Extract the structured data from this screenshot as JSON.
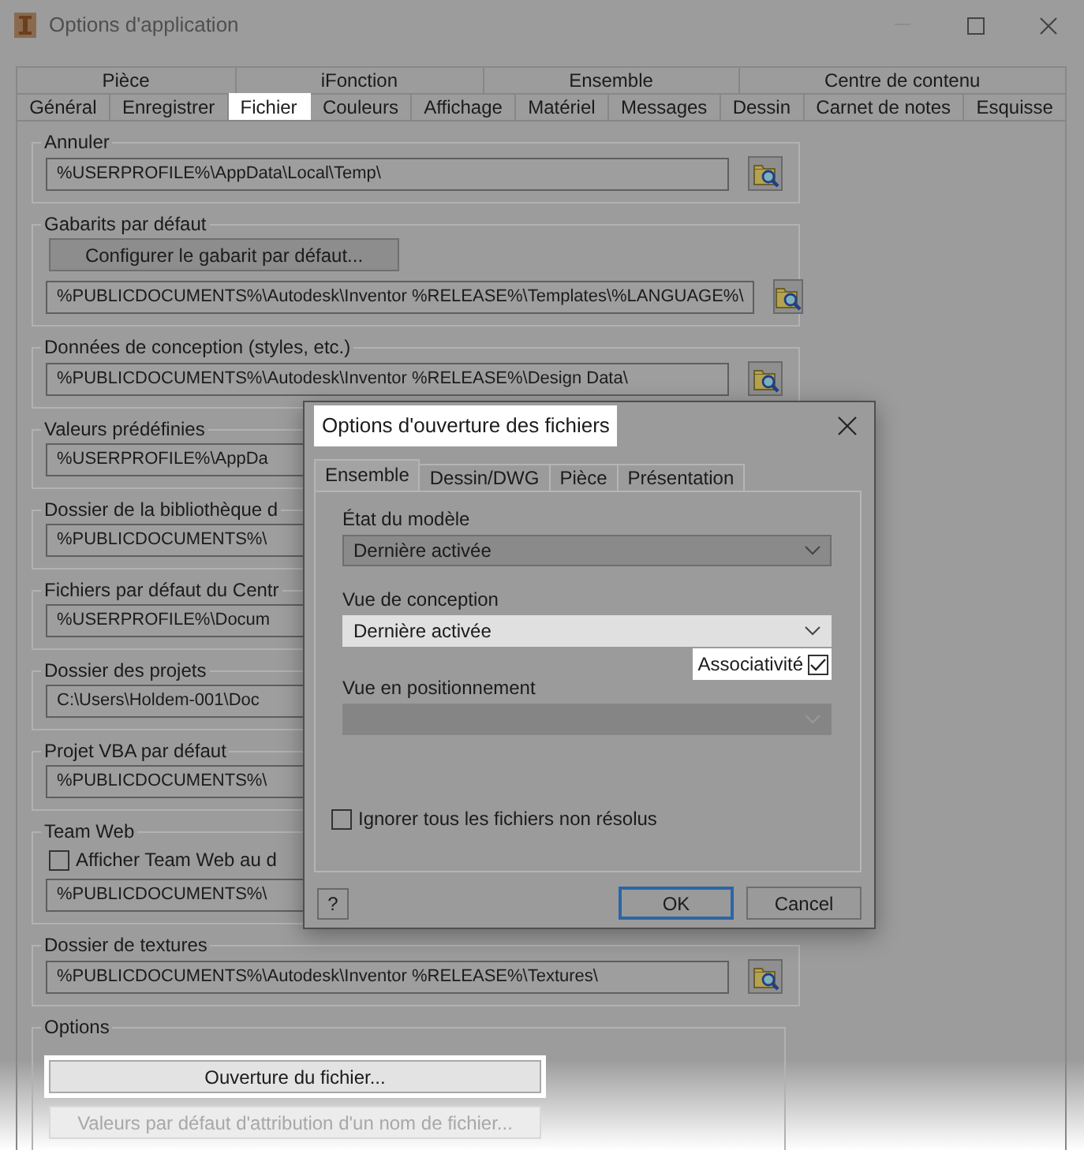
{
  "window": {
    "title": "Options d'application"
  },
  "tab_rows": [
    [
      {
        "label": "Pièce",
        "selected": false
      },
      {
        "label": "iFonction",
        "selected": false
      },
      {
        "label": "Ensemble",
        "selected": false
      },
      {
        "label": "Centre de contenu",
        "selected": false
      }
    ],
    [
      {
        "label": "Général",
        "selected": false
      },
      {
        "label": "Enregistrer",
        "selected": false
      },
      {
        "label": "Fichier",
        "selected": true
      },
      {
        "label": "Couleurs",
        "selected": false
      },
      {
        "label": "Affichage",
        "selected": false
      },
      {
        "label": "Matériel",
        "selected": false
      },
      {
        "label": "Messages",
        "selected": false
      },
      {
        "label": "Dessin",
        "selected": false
      },
      {
        "label": "Carnet de notes",
        "selected": false
      },
      {
        "label": "Esquisse",
        "selected": false
      }
    ]
  ],
  "groups": [
    {
      "legend": "Annuler",
      "path": "%USERPROFILE%\\AppData\\Local\\Temp\\",
      "browse": true
    },
    {
      "legend": "Gabarits par défaut",
      "button": "Configurer le gabarit par défaut...",
      "path": "%PUBLICDOCUMENTS%\\Autodesk\\Inventor %RELEASE%\\Templates\\%LANGUAGE%\\",
      "browse": true
    },
    {
      "legend": "Données de conception (styles, etc.)",
      "path": "%PUBLICDOCUMENTS%\\Autodesk\\Inventor %RELEASE%\\Design Data\\",
      "browse": true
    },
    {
      "legend": "Valeurs prédéfinies",
      "path": "%USERPROFILE%\\AppDa",
      "browse": false
    },
    {
      "legend": "Dossier de la bibliothèque d",
      "path": "%PUBLICDOCUMENTS%\\",
      "browse": false
    },
    {
      "legend": "Fichiers par défaut du Centr",
      "path": "%USERPROFILE%\\Docum",
      "browse": false
    },
    {
      "legend": "Dossier des projets",
      "path": "C:\\Users\\Holdem-001\\Doc",
      "browse": false
    },
    {
      "legend": "Projet VBA par défaut",
      "path": "%PUBLICDOCUMENTS%\\",
      "browse": false
    },
    {
      "legend": "Team Web",
      "checkbox": {
        "label": "Afficher Team Web au d",
        "checked": false
      },
      "path": "%PUBLICDOCUMENTS%\\",
      "browse": false
    },
    {
      "legend": "Dossier de textures",
      "path": "%PUBLICDOCUMENTS%\\Autodesk\\Inventor %RELEASE%\\Textures\\",
      "browse": true
    }
  ],
  "options": {
    "legend": "Options",
    "buttons": [
      {
        "label": "Ouverture du fichier...",
        "highlighted": true,
        "disabled": false
      },
      {
        "label": "Valeurs par défaut d'attribution d'un nom de fichier...",
        "highlighted": false,
        "disabled": true
      }
    ]
  },
  "dialog": {
    "title": "Options d'ouverture des fichiers",
    "title_highlighted": true,
    "tabs": [
      {
        "label": "Ensemble",
        "selected": true
      },
      {
        "label": "Dessin/DWG",
        "selected": false
      },
      {
        "label": "Pièce",
        "selected": false
      },
      {
        "label": "Présentation",
        "selected": false
      }
    ],
    "fields": [
      {
        "label": "État du modèle",
        "value": "Dernière activée",
        "focused": false,
        "disabled": false
      },
      {
        "label": "Vue de conception",
        "value": "Dernière activée",
        "focused": true,
        "disabled": false
      },
      {
        "label": "Vue en positionnement",
        "focused": false,
        "disabled": true
      }
    ],
    "associativity": {
      "label": "Associativité",
      "checked": true,
      "highlighted": true
    },
    "ignore_unresolved": {
      "label": "Ignorer tous les fichiers non résolus",
      "checked": false
    },
    "help": "?",
    "buttons": [
      {
        "label": "OK",
        "default": true
      },
      {
        "label": "Cancel",
        "default": false
      }
    ]
  }
}
